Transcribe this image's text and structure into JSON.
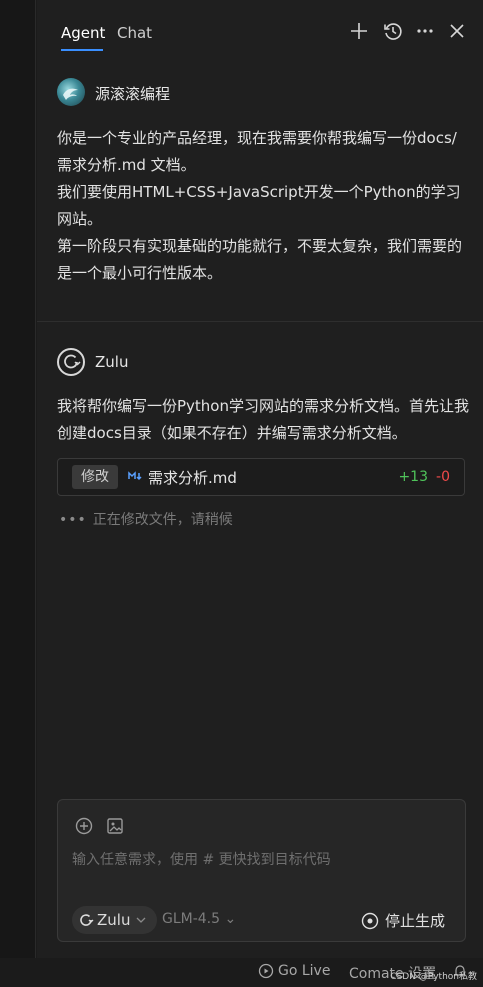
{
  "header": {
    "tabs": [
      {
        "label": "Agent",
        "active": true
      },
      {
        "label": "Chat",
        "active": false
      }
    ],
    "icons": [
      "plus-icon",
      "history-icon",
      "more-icon",
      "close-icon"
    ]
  },
  "user_message": {
    "author": "源滚滚编程",
    "lines": [
      "你是一个专业的产品经理，现在我需要你帮我编写一份docs/需求分析.md 文档。",
      "我们要使用HTML+CSS+JavaScript开发一个Python的学习网站。",
      "第一阶段只有实现基础的功能就行，不要太复杂，我们需要的是一个最小可行性版本。"
    ]
  },
  "ai_message": {
    "author": "Zulu",
    "text": "我将帮你编写一份Python学习网站的需求分析文档。首先让我创建docs目录（如果不存在）并编写需求分析文档。",
    "edit": {
      "badge": "修改",
      "file": "需求分析.md",
      "added": "+13",
      "removed": "-0"
    },
    "status": "正在修改文件，请稍候"
  },
  "input": {
    "placeholder": "输入任意需求，使用 # 更快找到目标代码",
    "agent_label": "Zulu",
    "model_label": "GLM-4.5",
    "stop_label": "停止生成"
  },
  "statusbar": {
    "go_live": "Go Live",
    "comate": "Comate 设置",
    "watermark": "CSDN @Python私教"
  },
  "colors": {
    "accent": "#3a8fff",
    "diff_add": "#4fc35a",
    "diff_del": "#f04a4a"
  }
}
